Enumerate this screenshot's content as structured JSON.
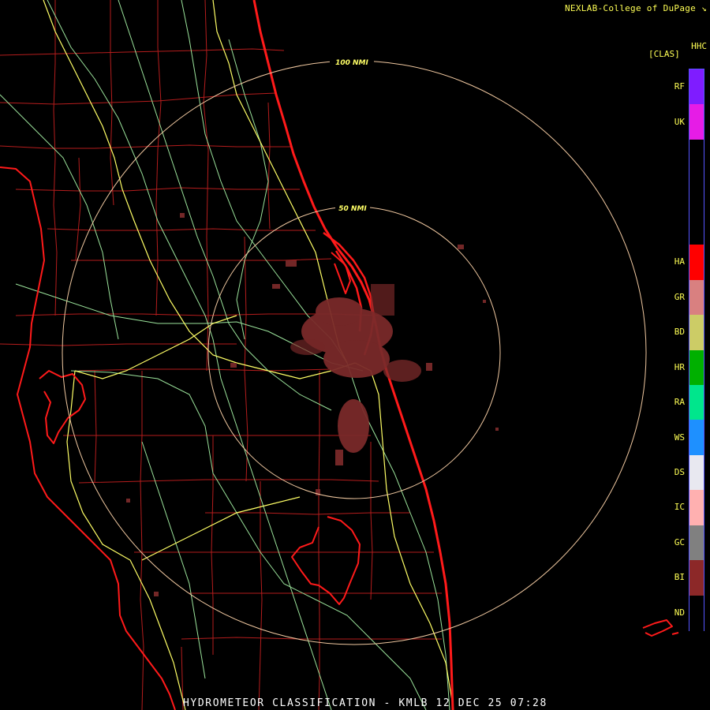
{
  "credit": "NEXLAB-College of DuPage",
  "credit_icon": "corner-arrow-icon",
  "product_code": "HHC",
  "units": "[CLAS]",
  "footer": "HYDROMETEOR CLASSIFICATION - KMLB 12 DEC 25 07:28",
  "rings": [
    {
      "label": "100 NMI"
    },
    {
      "label": "50 NMI"
    }
  ],
  "legend": [
    {
      "code": "RF",
      "color": "#7f1cff"
    },
    {
      "code": "UK",
      "color": "#e61ce6"
    },
    {
      "code": "",
      "color": "#000000"
    },
    {
      "code": "",
      "color": "#000000"
    },
    {
      "code": "",
      "color": "#000000"
    },
    {
      "code": "HA",
      "color": "#ff0000"
    },
    {
      "code": "GR",
      "color": "#d98080"
    },
    {
      "code": "BD",
      "color": "#cccc66"
    },
    {
      "code": "HR",
      "color": "#00b000"
    },
    {
      "code": "RA",
      "color": "#00e68c"
    },
    {
      "code": "WS",
      "color": "#1e90ff"
    },
    {
      "code": "DS",
      "color": "#e8e8f0"
    },
    {
      "code": "IC",
      "color": "#ffb0b0"
    },
    {
      "code": "GC",
      "color": "#808080"
    },
    {
      "code": "BI",
      "color": "#8c2828"
    },
    {
      "code": "ND",
      "color": "#000000"
    }
  ],
  "colors": {
    "coast": "#ff1a1a",
    "county": "#b51d1d",
    "interstate": "#ffff66",
    "highway": "#9be39b",
    "ring": "#f0c8a0",
    "echo": "#7a2a2a",
    "text": "#ffff55"
  }
}
